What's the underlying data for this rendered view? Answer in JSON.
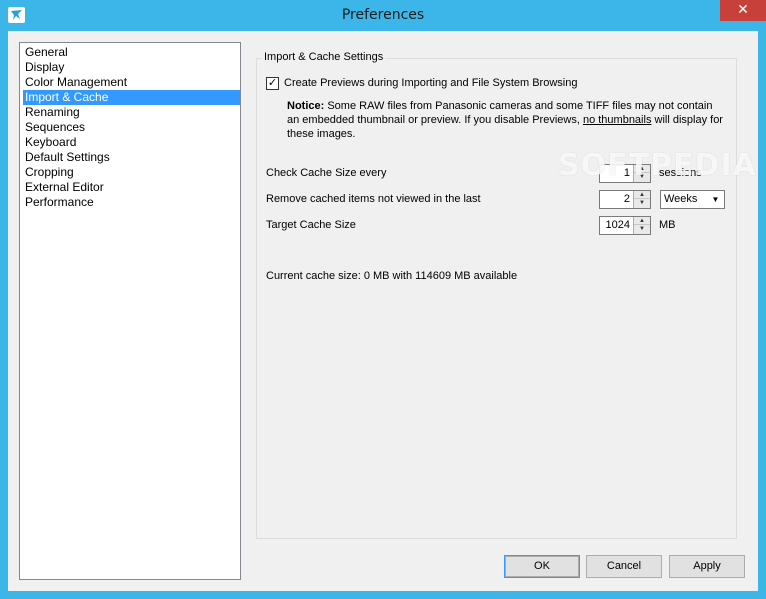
{
  "window": {
    "title": "Preferences",
    "close_glyph": "✕",
    "accent_color": "#3cb6e8"
  },
  "sidebar": {
    "items": [
      {
        "label": "General"
      },
      {
        "label": "Display"
      },
      {
        "label": "Color Management"
      },
      {
        "label": "Import & Cache",
        "selected": true
      },
      {
        "label": "Renaming"
      },
      {
        "label": "Sequences"
      },
      {
        "label": "Keyboard"
      },
      {
        "label": "Default Settings"
      },
      {
        "label": "Cropping"
      },
      {
        "label": "External Editor"
      },
      {
        "label": "Performance"
      }
    ]
  },
  "settings": {
    "group_title": "Import & Cache Settings",
    "create_previews": {
      "checked": true,
      "label": "Create Previews during Importing and File System Browsing"
    },
    "notice": {
      "heading": "Notice:",
      "text_before": " Some RAW files from Panasonic cameras and some TIFF files may not contain an embedded thumbnail or preview. If you disable Previews, ",
      "underlined": "no thumbnails",
      "text_after": " will display for these images."
    },
    "check_cache": {
      "label": "Check Cache Size every",
      "value": "1",
      "unit": "sessions"
    },
    "remove_cached": {
      "label": "Remove cached items not viewed in the last",
      "value": "2",
      "period": "Weeks"
    },
    "target_cache": {
      "label": "Target Cache Size",
      "value": "1024",
      "unit": "MB"
    },
    "status": "Current cache size: 0 MB with 114609 MB available"
  },
  "watermark": "SOFTPEDIA",
  "buttons": {
    "ok": "OK",
    "cancel": "Cancel",
    "apply": "Apply"
  }
}
